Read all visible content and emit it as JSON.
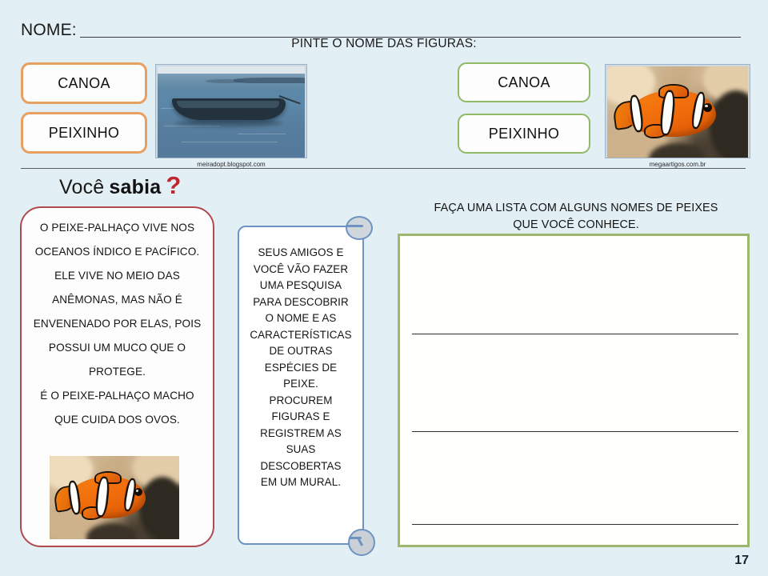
{
  "header": {
    "name_label": "NOME:",
    "name_value": "",
    "instruction": "PINTE O NOME DAS FIGURAS:"
  },
  "left_column": {
    "word_boxes": [
      {
        "label": "CANOA",
        "border_color": "#e8a061"
      },
      {
        "label": "PEIXINHO",
        "border_color": "#e8a061"
      }
    ],
    "photo": {
      "subject": "canoe-on-water-photo",
      "credit": "meiradopt.blogspot.com"
    }
  },
  "right_column": {
    "word_boxes": [
      {
        "label": "CANOA",
        "border_color": "#92b963"
      },
      {
        "label": "PEIXINHO",
        "border_color": "#92b963"
      }
    ],
    "photo": {
      "subject": "clownfish-photo",
      "credit": "megaartigos.com.br"
    }
  },
  "did_you_know": {
    "logo": {
      "word_1": "Você",
      "word_2": "sabia",
      "mark": "?",
      "mark_color": "#c0272d"
    },
    "border_color": "#b04a4f",
    "lines": [
      "O PEIXE-PALHAÇO VIVE NOS",
      "OCEANOS ÍNDICO E PACÍFICO.",
      "ELE VIVE NO MEIO DAS",
      "ANÊMONAS, MAS NÃO É",
      "ENVENENADO POR ELAS, POIS",
      "POSSUI UM MUCO QUE O",
      "PROTEGE.",
      "É O PEIXE-PALHAÇO MACHO",
      "QUE CUIDA DOS OVOS."
    ],
    "photo": {
      "subject": "clownfish-photo"
    }
  },
  "speech_bubble": {
    "border_color": "#6e93c2",
    "lines": [
      "SEUS AMIGOS E",
      "VOCÊ VÃO FAZER",
      "UMA PESQUISA",
      "PARA DESCOBRIR",
      "O NOME E AS",
      "CARACTERÍSTICAS",
      "DE OUTRAS",
      "ESPÉCIES DE",
      "PEIXE.",
      "PROCUREM",
      "FIGURAS E",
      "REGISTREM AS",
      "SUAS",
      "DESCOBERTAS",
      "EM UM MURAL."
    ]
  },
  "list_activity": {
    "prompt_line_1": "FAÇA UMA LISTA COM ALGUNS NOMES DE PEIXES",
    "prompt_line_2": "QUE VOCÊ CONHECE.",
    "border_color": "#9cb86f",
    "answer_lines": [
      "",
      "",
      ""
    ]
  },
  "footer": {
    "page_number": "17"
  },
  "theme": {
    "background": "#e2eff5",
    "text": "#141414"
  }
}
